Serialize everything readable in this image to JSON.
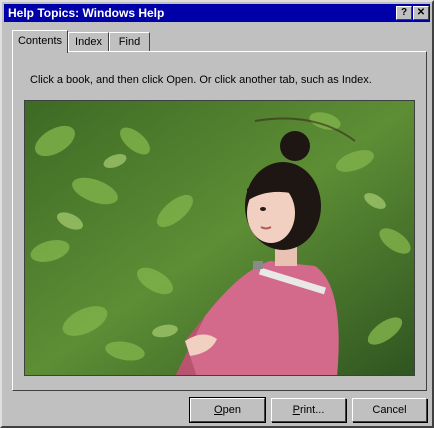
{
  "window": {
    "title": "Help Topics: Windows Help",
    "help_glyph": "?",
    "close_glyph": "✕"
  },
  "tabs": [
    {
      "label": "Contents",
      "active": true
    },
    {
      "label": "Index",
      "active": false
    },
    {
      "label": "Find",
      "active": false
    }
  ],
  "panel": {
    "instructions": "Click a book, and then click Open. Or click another tab, such as Index."
  },
  "buttons": {
    "open_first": "O",
    "open_rest": "pen",
    "print_first": "P",
    "print_rest": "rint...",
    "cancel": "Cancel"
  },
  "colors": {
    "title_bar": "#0000a8",
    "face": "#c0c0c0",
    "jacket": "#d36a8c",
    "foliage": "#4f7d2c"
  }
}
